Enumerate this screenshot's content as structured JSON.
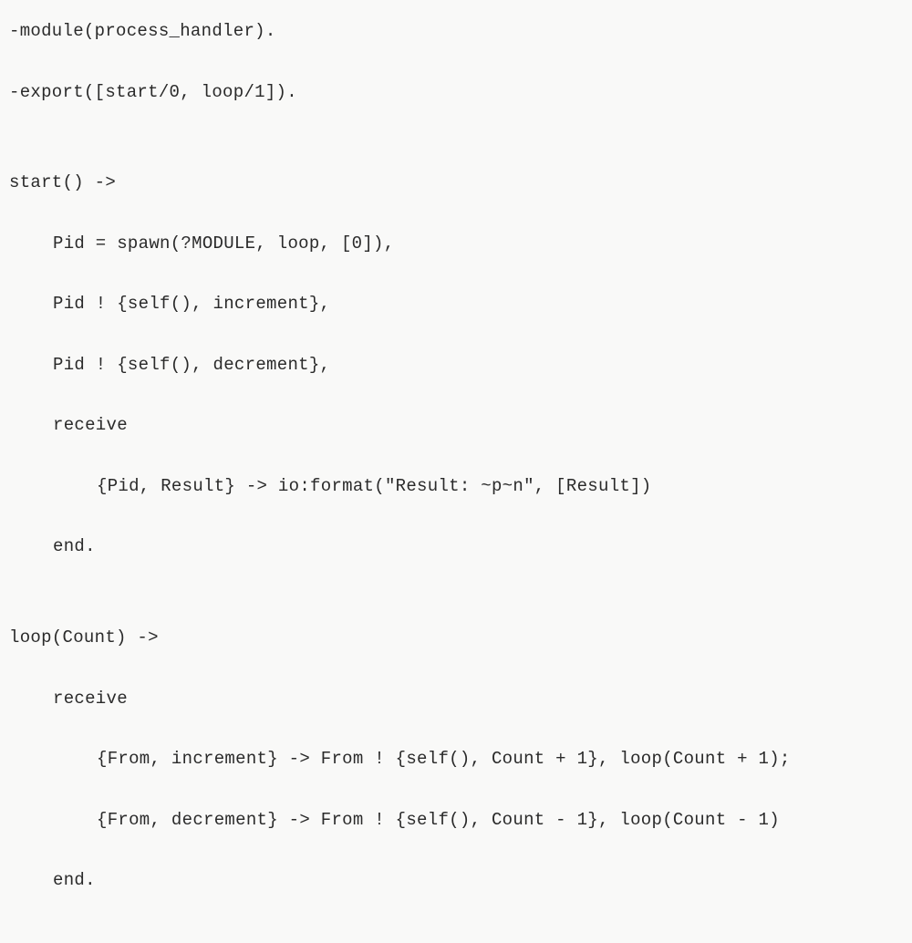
{
  "code": {
    "line1": "-module(process_handler).",
    "line2": "-export([start/0, loop/1]).",
    "line3": "",
    "line4": "start() ->",
    "line5": "Pid = spawn(?MODULE, loop, [0]),",
    "line6": "Pid ! {self(), increment},",
    "line7": "Pid ! {self(), decrement},",
    "line8": "receive",
    "line9": "{Pid, Result} -> io:format(\"Result: ~p~n\", [Result])",
    "line10": "end.",
    "line11": "",
    "line12": "loop(Count) ->",
    "line13": "receive",
    "line14": "{From, increment} -> From ! {self(), Count + 1}, loop(Count + 1);",
    "line15": "{From, decrement} -> From ! {self(), Count - 1}, loop(Count - 1)",
    "line16": "end."
  }
}
